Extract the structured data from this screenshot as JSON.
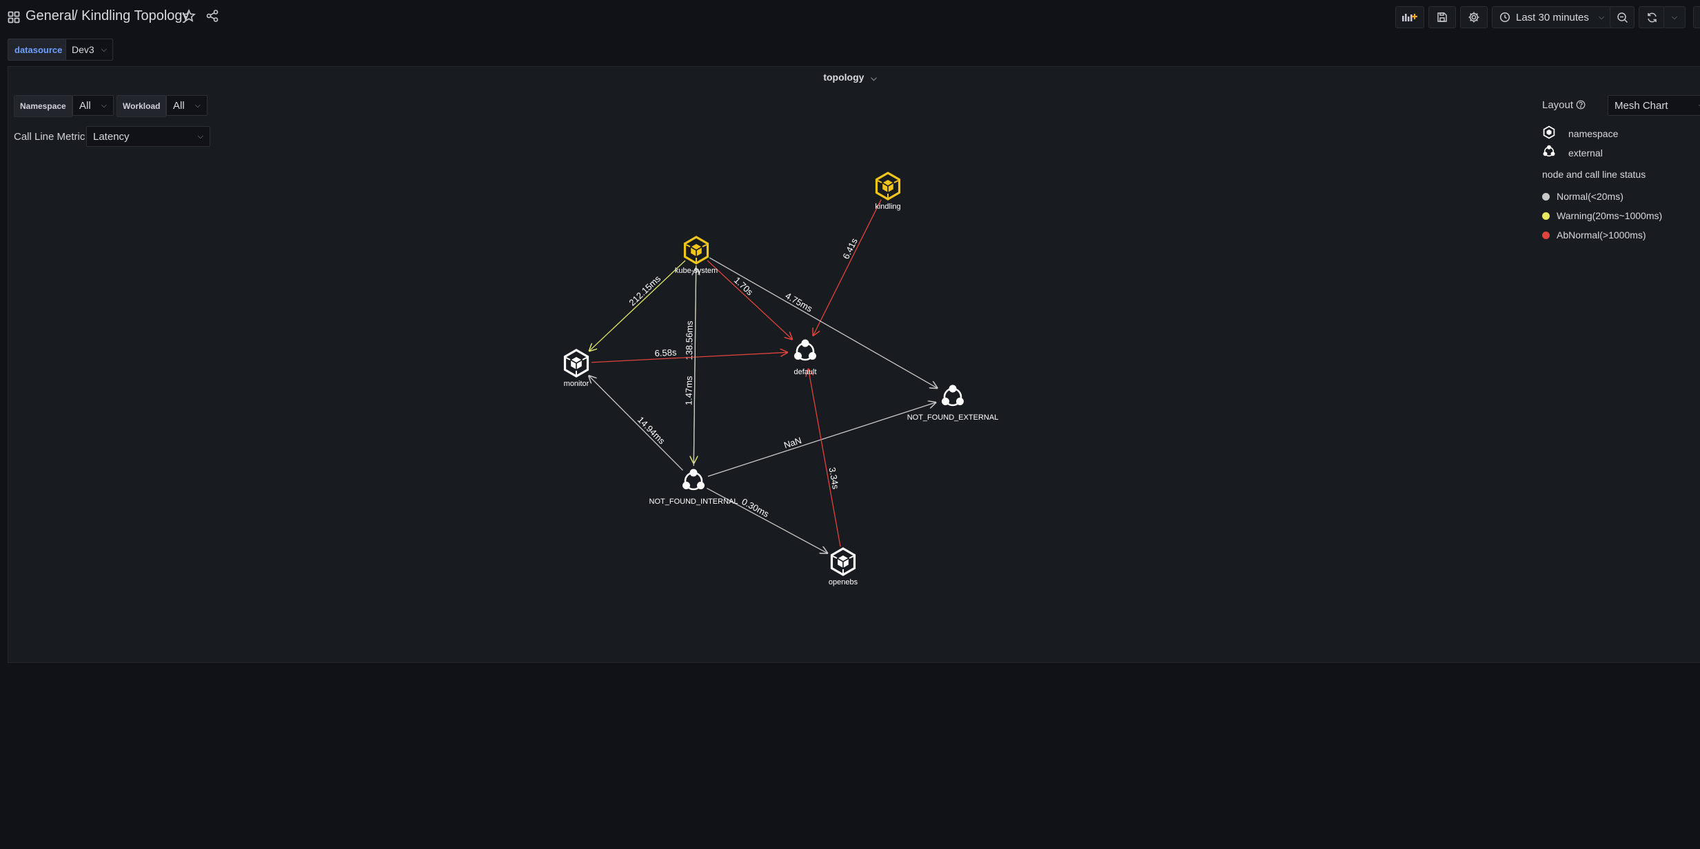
{
  "nav": {
    "section": "General",
    "title": "/ Kindling Topology",
    "time_range": "Last 30 minutes"
  },
  "variables": {
    "datasource_label": "datasource",
    "datasource_value": "Dev3"
  },
  "panel": {
    "title": "topology",
    "filters": {
      "namespace_label": "Namespace",
      "namespace_value": "All",
      "workload_label": "Workload",
      "workload_value": "All",
      "metric_label": "Call Line Metric",
      "metric_value": "Latency"
    },
    "legend": {
      "layout_label": "Layout",
      "layout_value": "Mesh Chart",
      "namespace_label": "namespace",
      "external_label": "external",
      "status_title": "node and call line status",
      "normal": "Normal(<20ms)",
      "warning": "Warning(20ms~1000ms)",
      "abnormal": "AbNormal(>1000ms)"
    }
  },
  "colors": {
    "normal": "#c8c8c8",
    "warning": "#e0e46a",
    "abnormal": "#e0443c",
    "node_warning": "#f2c51c",
    "accent": "#6e9fff"
  },
  "graph": {
    "nodes": [
      {
        "id": "kindling",
        "label": "kindling",
        "type": "namespace",
        "status": "warning"
      },
      {
        "id": "kube-system",
        "label": "kube-system",
        "type": "namespace",
        "status": "warning"
      },
      {
        "id": "monitor",
        "label": "monitor",
        "type": "namespace",
        "status": "normal"
      },
      {
        "id": "default",
        "label": "default",
        "type": "external",
        "status": "normal"
      },
      {
        "id": "nfe",
        "label": "NOT_FOUND_EXTERNAL",
        "type": "external",
        "status": "normal"
      },
      {
        "id": "nfi",
        "label": "NOT_FOUND_INTERNAL",
        "type": "external",
        "status": "normal"
      },
      {
        "id": "openebs",
        "label": "openebs",
        "type": "namespace",
        "status": "normal"
      }
    ],
    "edges": [
      {
        "from": "kindling",
        "to": "default",
        "label": "6.41s",
        "status": "abnormal"
      },
      {
        "from": "kube-system",
        "to": "monitor",
        "label": "212.15ms",
        "status": "warning"
      },
      {
        "from": "kube-system",
        "to": "default",
        "label": "1.70s",
        "status": "abnormal"
      },
      {
        "from": "kube-system",
        "to": "nfe",
        "label": "4.75ms",
        "status": "normal"
      },
      {
        "from": "kube-system",
        "to": "nfi",
        "label": "138.56ms",
        "status": "warning"
      },
      {
        "from": "monitor",
        "to": "default",
        "label": "6.58s",
        "status": "abnormal"
      },
      {
        "from": "nfi",
        "to": "monitor",
        "label": "14.94ms",
        "status": "normal"
      },
      {
        "from": "nfi",
        "to": "nfe",
        "label": "NaN",
        "status": "normal"
      },
      {
        "from": "nfi",
        "to": "openebs",
        "label": "0.30ms",
        "status": "normal"
      },
      {
        "from": "openebs",
        "to": "default",
        "label": "3.34s",
        "status": "abnormal"
      },
      {
        "from": "nfi",
        "to": "kube-system",
        "label": "1.47ms",
        "status": "normal"
      }
    ]
  }
}
